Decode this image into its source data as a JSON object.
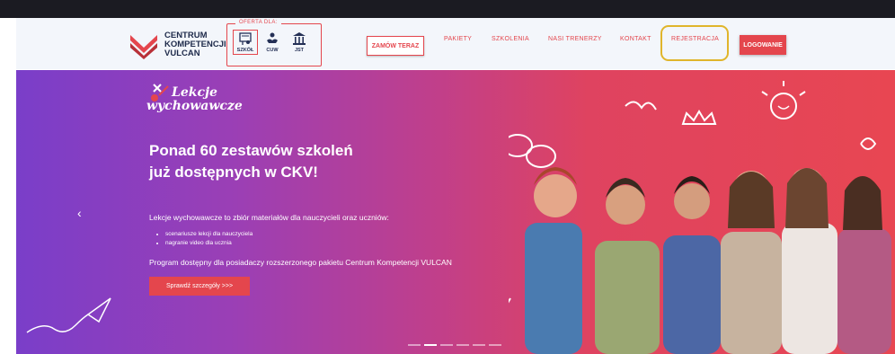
{
  "brand": {
    "line1": "CENTRUM",
    "line2": "KOMPETENCJI",
    "line3": "VULCAN"
  },
  "offer": {
    "label": "OFERTA DLA:",
    "items": [
      {
        "label": "SZKÓŁ",
        "icon": "school-icon"
      },
      {
        "label": "CUW",
        "icon": "hands-icon"
      },
      {
        "label": "JST",
        "icon": "building-icon"
      }
    ]
  },
  "nav": {
    "order": "ZAMÓW TERAZ",
    "packages": "PAKIETY",
    "trainings": "SZKOLENIA",
    "trainers": "NASI TRENERZY",
    "contact": "KONTAKT",
    "register": "REJESTRACJA",
    "login": "LOGOWANIE"
  },
  "hero": {
    "script_line1": "Lekcje",
    "script_line2": "wychowawcze",
    "title_line1": "Ponad 60 zestawów szkoleń",
    "title_line2": "już dostępnych w CKV!",
    "description": "Lekcje wychowawcze to zbiór materiałów dla nauczycieli oraz uczniów:",
    "bullets": [
      "scenariusze lekcji dla nauczyciela",
      "nagranie video dla ucznia"
    ],
    "program": "Program dostępny dla posiadaczy rozszerzonego pakietu Centrum Kompetencji VULCAN",
    "cta": "Sprawdź szczegóły >>>",
    "prev_arrow": "‹"
  },
  "slider": {
    "count": 6,
    "active": 1
  },
  "colors": {
    "accent": "#e4464d",
    "highlight": "#e0b52b",
    "navy": "#1e2a4a"
  }
}
